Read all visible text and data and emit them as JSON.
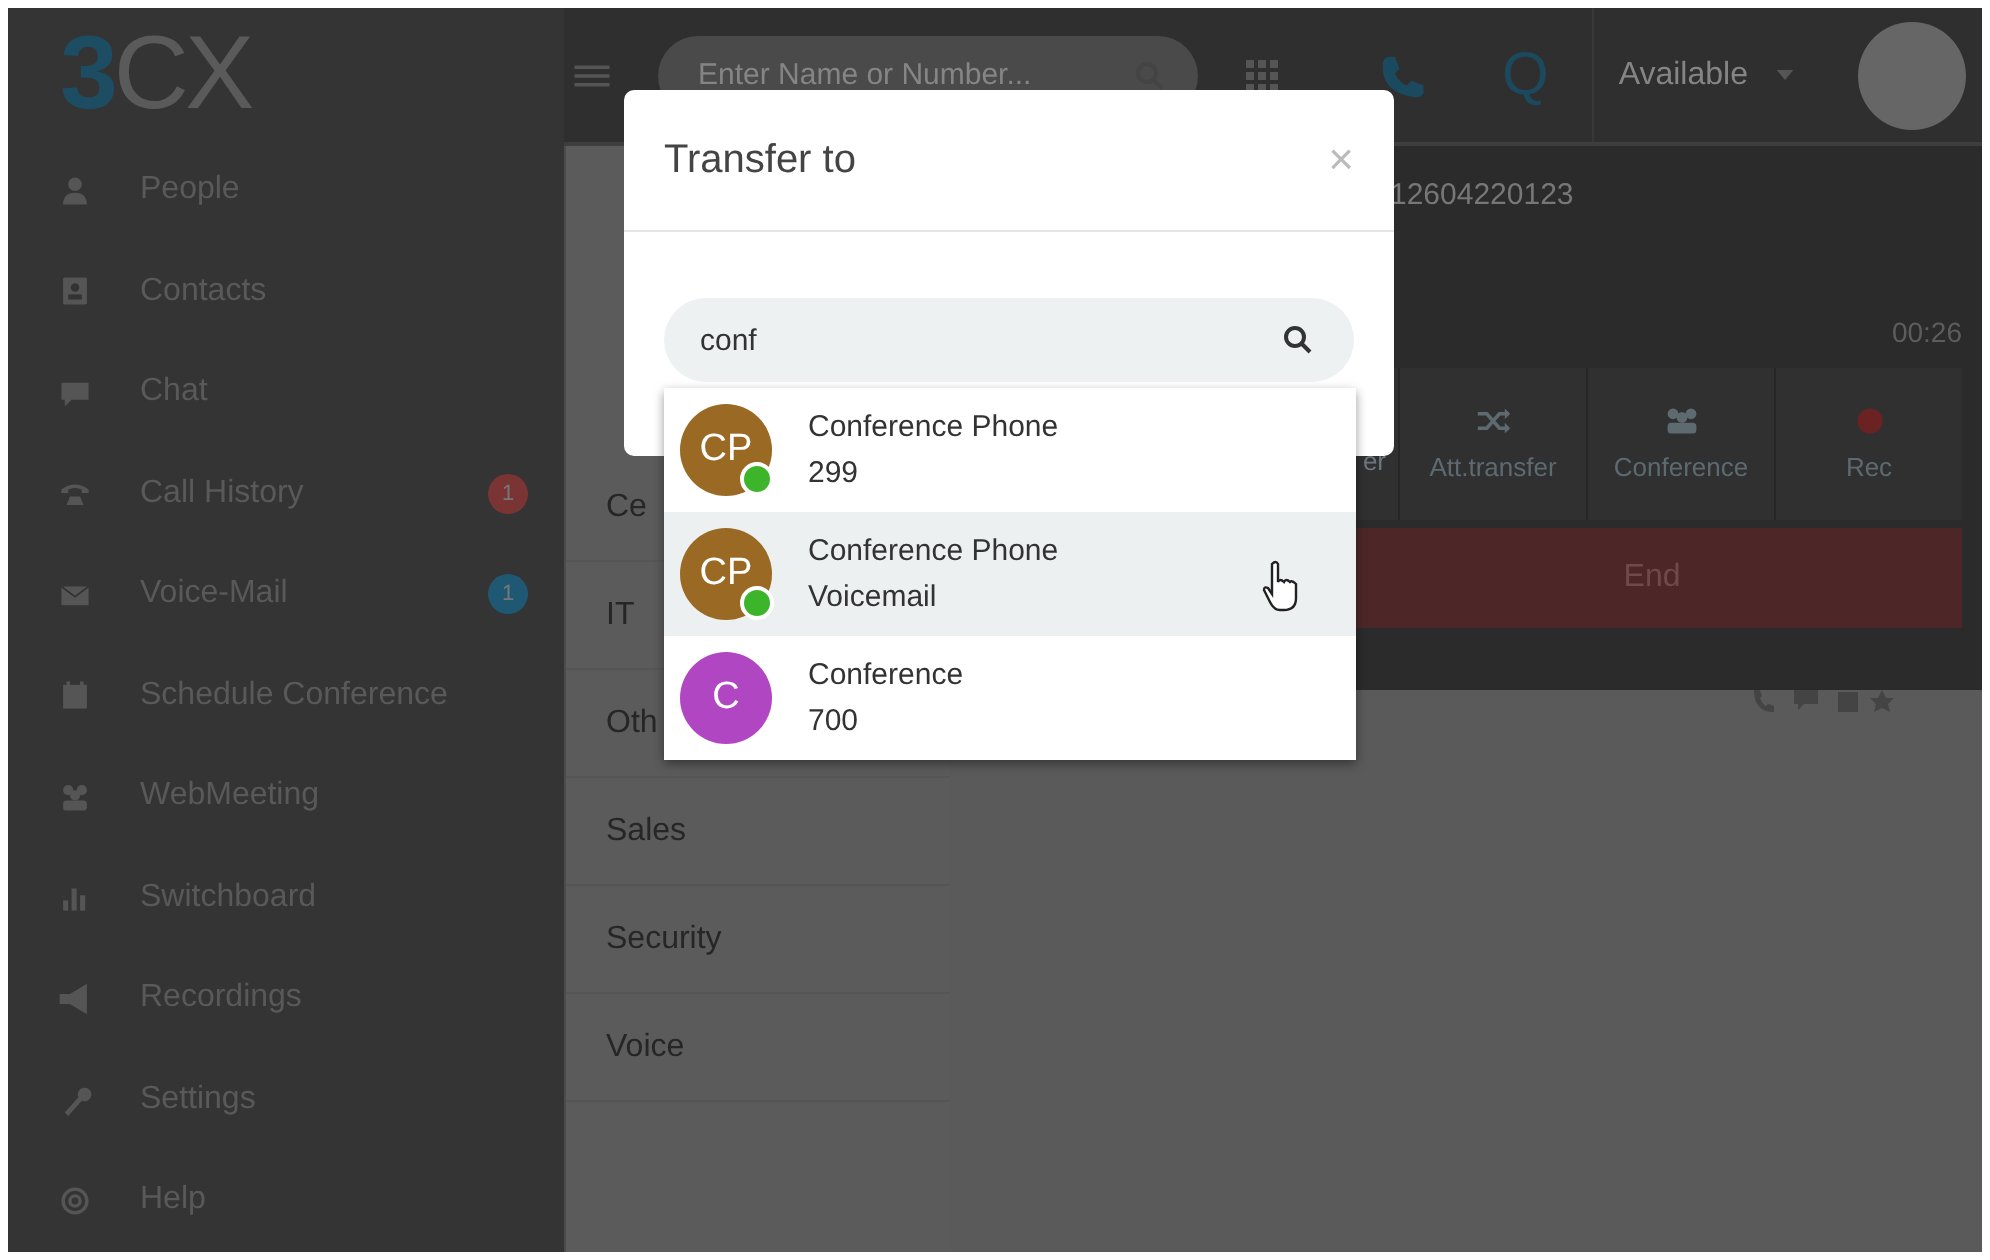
{
  "logo": {
    "accent": "3",
    "rest": "CX"
  },
  "sidebar": {
    "items": [
      {
        "label": "People"
      },
      {
        "label": "Contacts"
      },
      {
        "label": "Chat"
      },
      {
        "label": "Call History",
        "badge": "1",
        "color": "#7a3434"
      },
      {
        "label": "Voice-Mail",
        "badge": "1",
        "color": "#1f5873"
      },
      {
        "label": "Schedule Conference"
      },
      {
        "label": "WebMeeting"
      },
      {
        "label": "Switchboard"
      },
      {
        "label": "Recordings"
      },
      {
        "label": "Settings"
      },
      {
        "label": "Help"
      }
    ]
  },
  "topbar": {
    "search": {
      "placeholder": "Enter Name or Number..."
    },
    "queue_label": "Q",
    "status": "Available"
  },
  "groups": [
    "Ce",
    "IT",
    "Oth",
    "Sales",
    "Security",
    "Voice"
  ],
  "call": {
    "number": "12604220123",
    "timer": "00:26",
    "actions": [
      {
        "label": "er",
        "kind": "text"
      },
      {
        "label": "Att.transfer",
        "kind": "shuffle"
      },
      {
        "label": "Conference",
        "kind": "group"
      },
      {
        "label": "Rec",
        "kind": "record"
      }
    ],
    "end": "End"
  },
  "dialog": {
    "title": "Transfer to",
    "close": "×",
    "search": {
      "value": "conf"
    },
    "results": [
      {
        "initials": "CP",
        "color": "#9a6a24",
        "online": true,
        "name": "Conference Phone",
        "detail": "299",
        "selected": false
      },
      {
        "initials": "CP",
        "color": "#9a6a24",
        "online": true,
        "name": "Conference Phone",
        "detail": "Voicemail",
        "selected": true
      },
      {
        "initials": "C",
        "color": "#b146c2",
        "online": false,
        "name": "Conference",
        "detail": "700",
        "selected": false
      }
    ]
  }
}
